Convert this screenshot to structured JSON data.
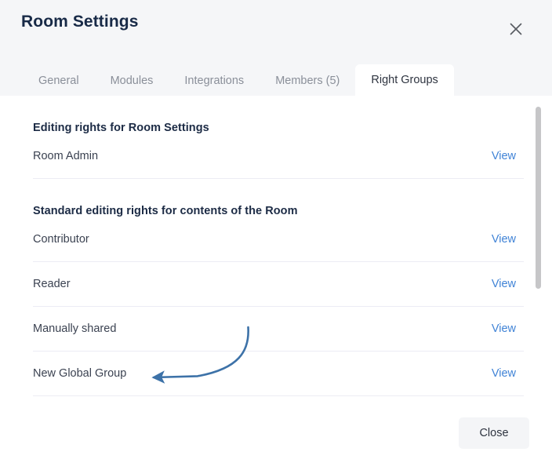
{
  "dialog": {
    "title": "Room Settings",
    "close_icon": "close-icon"
  },
  "tabs": [
    {
      "label": "General",
      "active": false
    },
    {
      "label": "Modules",
      "active": false
    },
    {
      "label": "Integrations",
      "active": false
    },
    {
      "label": "Members (5)",
      "active": false
    },
    {
      "label": "Right Groups",
      "active": true
    }
  ],
  "sections": [
    {
      "heading": "Editing rights for Room Settings",
      "rows": [
        {
          "label": "Room Admin",
          "action": "View"
        }
      ]
    },
    {
      "heading": "Standard editing rights for contents of the Room",
      "rows": [
        {
          "label": "Contributor",
          "action": "View"
        },
        {
          "label": "Reader",
          "action": "View"
        },
        {
          "label": "Manually shared",
          "action": "View"
        },
        {
          "label": "New Global Group",
          "action": "View"
        }
      ]
    }
  ],
  "footer": {
    "close_label": "Close"
  },
  "annotation": {
    "type": "curved-arrow",
    "color": "#3d72a8",
    "points_to": "New Global Group"
  },
  "colors": {
    "header_bg": "#f5f6f8",
    "body_bg": "#ffffff",
    "title": "#182a47",
    "tab_inactive": "#8a8f99",
    "tab_active": "#2e3440",
    "link": "#4083d6",
    "divider": "#ececf4",
    "scrollbar": "#c6c6c8",
    "button_bg": "#f4f5f7"
  }
}
